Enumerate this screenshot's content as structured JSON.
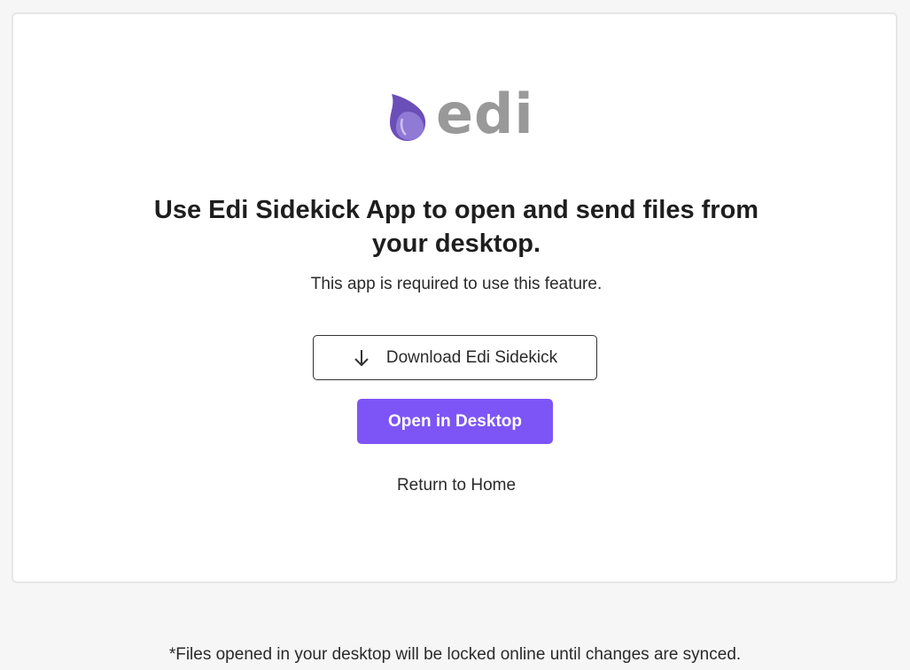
{
  "logo": {
    "text": "edi",
    "icon": "edi-drop-logo-icon",
    "icon_colors": [
      "#6b4fb8",
      "#8f7ad6"
    ]
  },
  "main": {
    "headline_line1": "Use Edi Sidekick App to open and send files from",
    "headline_line2": "your desktop.",
    "subtext": "This app is required to use this feature.",
    "download_label": "Download Edi Sidekick",
    "download_icon": "arrow-down-icon",
    "open_label": "Open in Desktop",
    "return_label": "Return to Home"
  },
  "footnote": "*Files opened in your desktop will be locked online until changes are synced.",
  "colors": {
    "accent": "#7d55f6",
    "page_background": "#f6f6f6",
    "card_background": "#ffffff",
    "logo_text": "#999999"
  }
}
